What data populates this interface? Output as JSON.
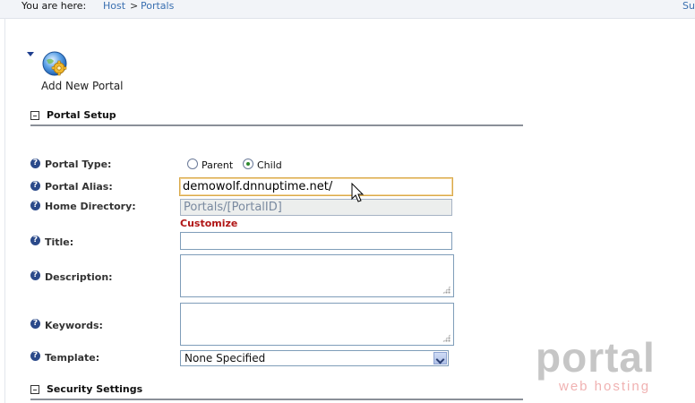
{
  "breadcrumb": {
    "prefix": "You are here:",
    "items": [
      "Host",
      "Portals"
    ],
    "separator": ">",
    "right_link": "Su"
  },
  "add_action": {
    "label": "Add New Portal",
    "icon": "globe-gear-icon"
  },
  "sections": {
    "portal_setup": "Portal Setup",
    "security_settings": "Security Settings"
  },
  "form": {
    "portal_type": {
      "label": "Portal Type:",
      "options": [
        {
          "label": "Parent",
          "selected": false
        },
        {
          "label": "Child",
          "selected": true
        }
      ]
    },
    "portal_alias": {
      "label": "Portal Alias:",
      "value": "demowolf.dnnuptime.net/"
    },
    "home_directory": {
      "label": "Home Directory:",
      "value": "Portals/[PortalID]",
      "link": "Customize"
    },
    "title": {
      "label": "Title:",
      "value": ""
    },
    "description": {
      "label": "Description:",
      "value": ""
    },
    "keywords": {
      "label": "Keywords:",
      "value": ""
    },
    "template": {
      "label": "Template:",
      "selected": "None Specified"
    }
  },
  "watermark": {
    "brand": "portal",
    "tagline": "web hosting"
  },
  "colors": {
    "link": "#3a6fb0",
    "help_icon": "#2b4a8a",
    "customize": "#b01515",
    "focus_border": "#d9a94a"
  }
}
